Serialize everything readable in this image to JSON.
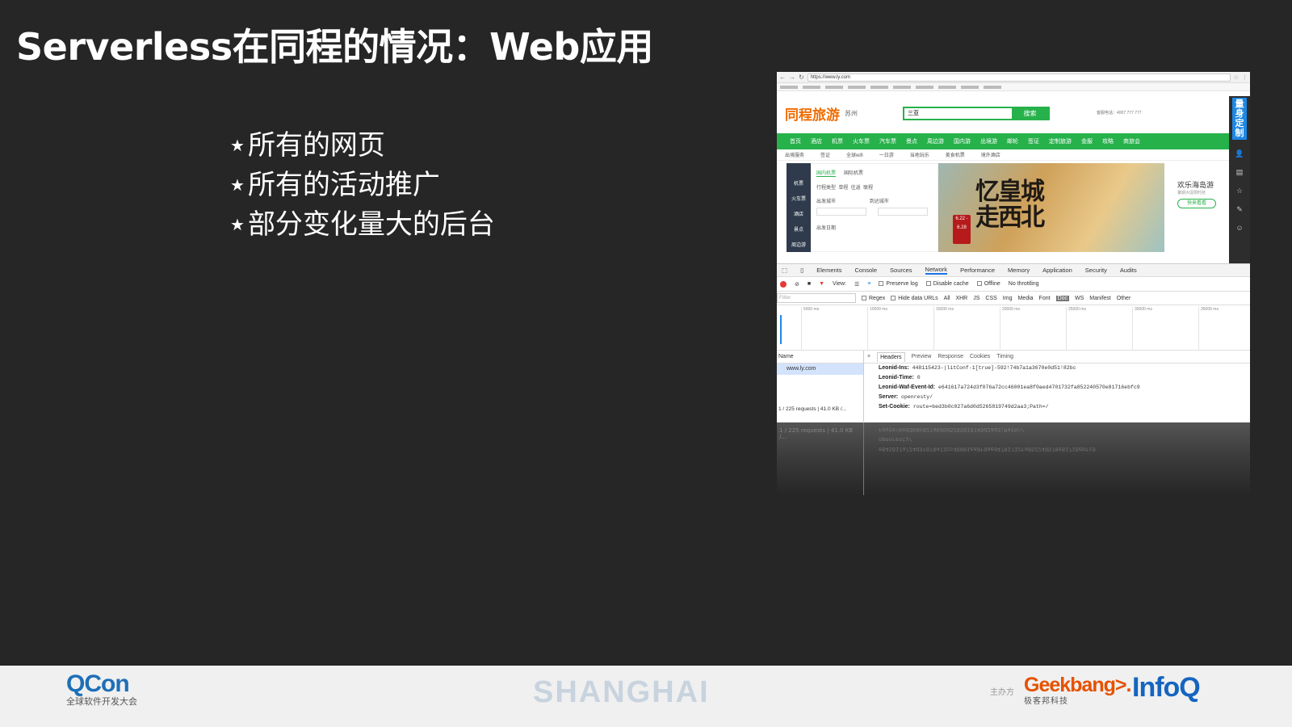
{
  "slide": {
    "title": "Serverless在同程的情况：Web应用",
    "bullets": [
      "所有的网页",
      "所有的活动推广",
      "部分变化量大的后台"
    ],
    "bullet_icon": "star-icon"
  },
  "browser": {
    "url": "https://www.ly.com",
    "site": {
      "logo": "同程旅游",
      "city": "苏州",
      "search_value": "三亚",
      "search_button": "搜索",
      "hotline": "客服电话：4007 777 777",
      "nav": [
        "首页",
        "酒店",
        "机票",
        "火车票",
        "汽车票",
        "景点",
        "周边游",
        "国内游",
        "出境游",
        "邮轮",
        "签证",
        "定制旅游",
        "金服",
        "攻略",
        "商旅会"
      ],
      "sub_nav": [
        "出境服务",
        "签证",
        "全球wifi",
        "一日游",
        "当地玩乐",
        "美食机票",
        "境外酒店"
      ],
      "side_menu": [
        "机票",
        "火车票",
        "酒店",
        "景点",
        "周边游"
      ],
      "ticket_tabs": [
        "国内机票",
        "国际机票"
      ],
      "trip_type_label": "行程类型",
      "trip_types": [
        "单程",
        "往返",
        "联程"
      ],
      "depart_label": "出发城市",
      "arrive_label": "到达城市",
      "date_label": "出发日期",
      "city_placeholder": "城市名",
      "banner_text_line1": "忆皇城",
      "banner_text_line2": "走西北",
      "banner_date": "6.22 - 6.28",
      "promo_title": "欢乐海岛游",
      "promo_sub": "暑期大促限时抢",
      "promo_button": "快来看看",
      "custom_label": "量身定制"
    }
  },
  "devtools": {
    "tabs": [
      "Elements",
      "Console",
      "Sources",
      "Network",
      "Performance",
      "Memory",
      "Application",
      "Security",
      "Audits"
    ],
    "active_tab": "Network",
    "toolbar": {
      "view_label": "View:",
      "preserve_log": "Preserve log",
      "disable_cache": "Disable cache",
      "offline": "Offline",
      "throttling": "No throttling"
    },
    "filter": {
      "placeholder": "Filter",
      "regex": "Regex",
      "hide_data_urls": "Hide data URLs",
      "types": [
        "All",
        "XHR",
        "JS",
        "CSS",
        "Img",
        "Media",
        "Font",
        "Doc",
        "WS",
        "Manifest",
        "Other"
      ],
      "selected_type": "Doc"
    },
    "timeline_ticks": [
      "5000 ms",
      "10000 ms",
      "15000 ms",
      "20000 ms",
      "25000 ms",
      "30000 ms",
      "35000 ms"
    ],
    "request_list": {
      "header": "Name",
      "rows": [
        "www.ly.com"
      ],
      "summary": "1 / 225 requests | 41.0 KB /..."
    },
    "detail_tabs": [
      "Headers",
      "Preview",
      "Response",
      "Cookies",
      "Timing"
    ],
    "active_detail_tab": "Headers",
    "headers": [
      {
        "name": "Leonid-Ins:",
        "value": "448115423-|litConf-1[true]-592!74b7a1a3670e0d51!82bc"
      },
      {
        "name": "Leonid-Time:",
        "value": "0"
      },
      {
        "name": "Leonid-Waf-Event-Id:",
        "value": "e641617a724d3f076a72cc46001ea8f0aed4701732fa852240570e81716ebfc9"
      },
      {
        "name": "Server:",
        "value": "openresty/"
      },
      {
        "name": "Set-Cookie:",
        "value": "route=bed3b0c027a6d0d5265819749d2aa3;Path=/"
      }
    ]
  },
  "footer": {
    "qcon_logo": "QCon",
    "qcon_sub": "全球软件开发大会",
    "city": "SHANGHAI",
    "organizer_label": "主办方",
    "geekbang": "Geekbang>.",
    "geekbang_cn": "极客邦科技",
    "infoq": "InfoQ"
  }
}
